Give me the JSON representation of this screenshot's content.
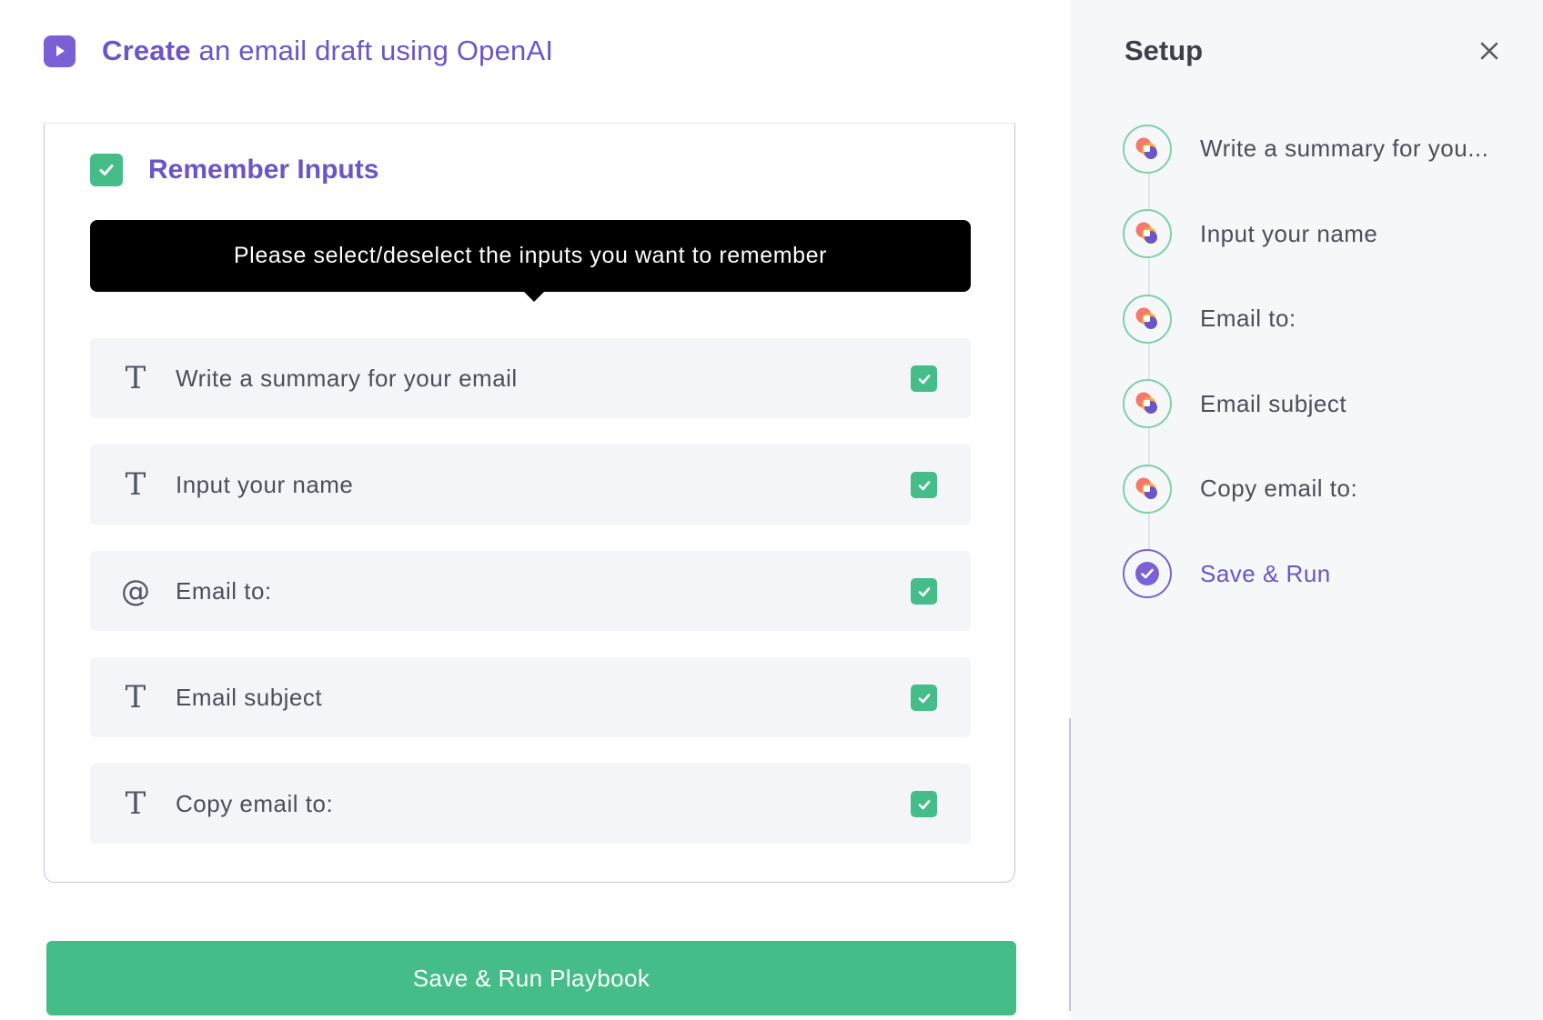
{
  "header": {
    "title_strong": "Create",
    "title_rest": " an email draft using OpenAI",
    "icon": "play-icon"
  },
  "card": {
    "remember_label": "Remember Inputs",
    "remember_checked": true,
    "tooltip": "Please select/deselect the inputs you want to remember",
    "rows": [
      {
        "icon": "text-type-icon",
        "glyph": "T",
        "label": "Write a summary for your email",
        "checked": true
      },
      {
        "icon": "text-type-icon",
        "glyph": "T",
        "label": "Input your name",
        "checked": true
      },
      {
        "icon": "email-type-icon",
        "glyph": "@",
        "label": "Email to:",
        "checked": true
      },
      {
        "icon": "text-type-icon",
        "glyph": "T",
        "label": "Email subject",
        "checked": true
      },
      {
        "icon": "text-type-icon",
        "glyph": "T",
        "label": "Copy email to:",
        "checked": true
      }
    ]
  },
  "run_button_label": "Save & Run Playbook",
  "sidebar": {
    "title": "Setup",
    "close_icon": "close-icon",
    "steps": [
      {
        "label": "Write a summary for you...",
        "icon": "app-logo-icon"
      },
      {
        "label": "Input your name",
        "icon": "app-logo-icon"
      },
      {
        "label": "Email to:",
        "icon": "app-logo-icon"
      },
      {
        "label": "Email subject",
        "icon": "app-logo-icon"
      },
      {
        "label": "Copy email to:",
        "icon": "app-logo-icon"
      },
      {
        "label": "Save & Run",
        "icon": "check-circle-icon",
        "active": true
      }
    ]
  },
  "colors": {
    "accent_purple": "#6b55c8",
    "success_green": "#44bd89",
    "tooltip_bg": "#000000",
    "sidebar_bg": "#f6f7f9"
  }
}
